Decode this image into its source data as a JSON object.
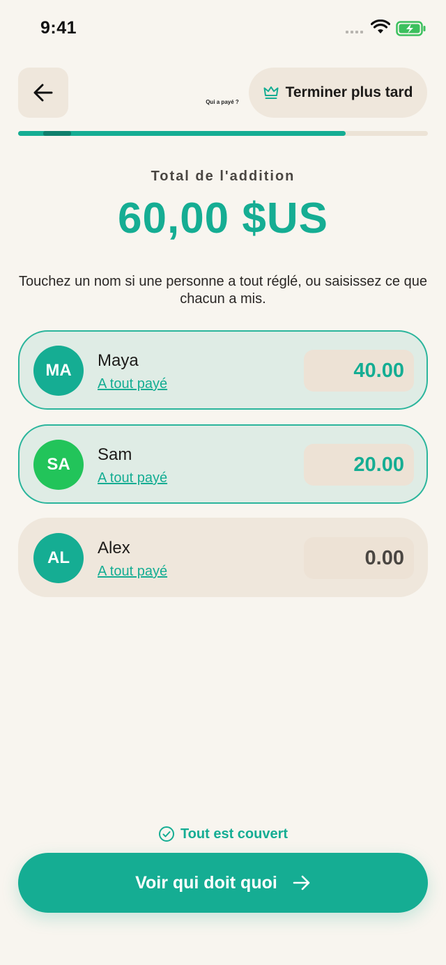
{
  "status_bar": {
    "time": "9:41"
  },
  "header": {
    "title": "Qui a payé ?",
    "finish_later_label": "Terminer plus tard"
  },
  "progress": {
    "fraction": 0.8
  },
  "bill": {
    "total_label": "Total de l'addition",
    "total_amount": "60,00 $US",
    "instructions": "Touchez un nom si une personne a tout réglé, ou saisissez ce que chacun a mis."
  },
  "people": [
    {
      "initials": "MA",
      "name": "Maya",
      "paid_link": "A tout payé",
      "amount": "40.00",
      "avatar_color": "#15ad93",
      "amount_color": "#15ad93",
      "highlighted": true
    },
    {
      "initials": "SA",
      "name": "Sam",
      "paid_link": "A tout payé",
      "amount": "20.00",
      "avatar_color": "#22c45a",
      "amount_color": "#15ad93",
      "highlighted": true
    },
    {
      "initials": "AL",
      "name": "Alex",
      "paid_link": "A tout payé",
      "amount": "0.00",
      "avatar_color": "#15ad93",
      "amount_color": "#4a4642",
      "highlighted": false
    }
  ],
  "footer": {
    "status_text": "Tout est couvert",
    "cta_label": "Voir qui doit quoi"
  },
  "colors": {
    "accent": "#15ad93",
    "background": "#f8f5ef",
    "card": "#efe7dc",
    "card_highlighted": "#dfece5"
  },
  "icons": [
    "back-arrow-icon",
    "crown-icon",
    "check-circle-icon",
    "arrow-right-icon",
    "wifi-icon",
    "battery-icon",
    "signal-icon"
  ]
}
